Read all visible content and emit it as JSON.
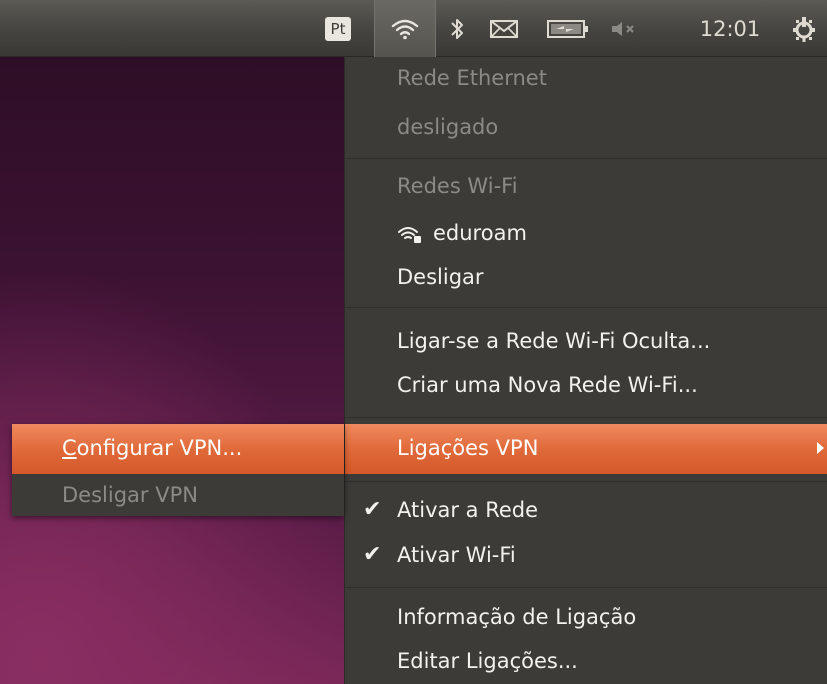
{
  "panel": {
    "keyboard_layout": "Pt",
    "clock": "12:01",
    "icons": [
      "wifi-icon",
      "bluetooth-icon",
      "mail-icon",
      "battery-icon",
      "volume-muted-icon",
      "power-settings-icon"
    ]
  },
  "menu": {
    "ethernet_header": "Rede Ethernet",
    "ethernet_status": "desligado",
    "wifi_header": "Redes Wi-Fi",
    "wifi_network": "eduroam",
    "disconnect": "Desligar",
    "hidden_network": "Ligar-se a Rede Wi-Fi Oculta...",
    "new_network": "Criar uma Nova Rede Wi-Fi...",
    "vpn_connections": "Ligações VPN",
    "enable_network": "Ativar a Rede",
    "enable_wifi": "Ativar Wi-Fi",
    "connection_info": "Informação de Ligação",
    "edit_connections": "Editar Ligações..."
  },
  "submenu": {
    "configure_vpn_mnemonic": "C",
    "configure_vpn_rest": "onfigurar VPN...",
    "disconnect_vpn": "Desligar VPN"
  },
  "colors": {
    "accent": "#e06a3a",
    "menu_bg": "#3c3b37",
    "panel_bg": "#454440"
  }
}
